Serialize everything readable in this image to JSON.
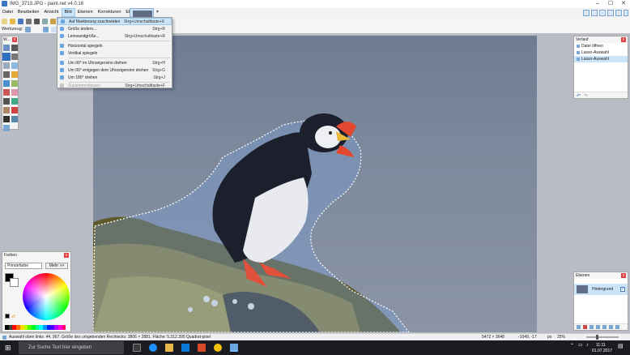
{
  "window": {
    "title": "IMG_3713.JPG - paint.net v4.0.16",
    "controls": [
      "–",
      "☐",
      "✕"
    ]
  },
  "menu": {
    "items": [
      "Datei",
      "Bearbeiten",
      "Ansicht",
      "Bild",
      "Ebenen",
      "Korrekturen",
      "Effekte"
    ],
    "open_index": 3
  },
  "toolbar2": {
    "tool_label": "Werkzeug:"
  },
  "image_menu": {
    "items": [
      {
        "label": "Auf Markierung zuschneiden",
        "shortcut": "Strg+Umschalttaste+X",
        "highlighted": true,
        "disabled": false
      },
      {
        "label": "Größe ändern...",
        "shortcut": "Strg+R",
        "highlighted": false,
        "disabled": false
      },
      {
        "label": "Leinwandgröße...",
        "shortcut": "Strg+Umschalttaste+R",
        "highlighted": false,
        "disabled": false
      },
      {
        "label": "Horizontal spiegeln",
        "shortcut": "",
        "highlighted": false,
        "disabled": false
      },
      {
        "label": "Vertikal spiegeln",
        "shortcut": "",
        "highlighted": false,
        "disabled": false
      },
      {
        "label": "Um 90° im Uhrzeigersinn drehen",
        "shortcut": "Strg+H",
        "highlighted": false,
        "disabled": false
      },
      {
        "label": "Um 90° entgegen dem Uhrzeigersinn drehen",
        "shortcut": "Strg+G",
        "highlighted": false,
        "disabled": false
      },
      {
        "label": "Um 180° drehen",
        "shortcut": "Strg+J",
        "highlighted": false,
        "disabled": false
      },
      {
        "label": "Zusammenfassen",
        "shortcut": "Strg+Umschalttaste+F",
        "highlighted": false,
        "disabled": true
      }
    ]
  },
  "tools_panel": {
    "title": "W...",
    "close": "x"
  },
  "history_panel": {
    "title": "Verlauf",
    "close": "x",
    "items": [
      {
        "label": "Datei öffnen",
        "selected": false
      },
      {
        "label": "Lasso-Auswahl",
        "selected": false
      },
      {
        "label": "Lasso-Auswahl",
        "selected": true
      }
    ]
  },
  "layers_panel": {
    "title": "Ebenen",
    "close": "x",
    "layer_name": "Hintergrund",
    "layer_check": "✓"
  },
  "colors_panel": {
    "title": "Farben",
    "close": "x",
    "select_value": "Primärfarbe",
    "more_button": "Mehr >>"
  },
  "status": {
    "left_text": "Auswahl oben links: 44, 967. Größe des umgebenden Rechtecks: 3806 × 2881. Fläche: 5.312.390 Quadrat-pixel",
    "image_size": "5472 × 3648",
    "cursor_pos": "-1049, -17",
    "unit": "px",
    "zoom": "25%"
  },
  "taskbar": {
    "search_placeholder": "Zur Suche Text hier eingeben",
    "time": "11:11",
    "date": "01.07.2017"
  },
  "colors": {
    "accent": "#0078d7",
    "menu_highlight": "#cce4f7",
    "canvas_sky": "#7d899c"
  }
}
